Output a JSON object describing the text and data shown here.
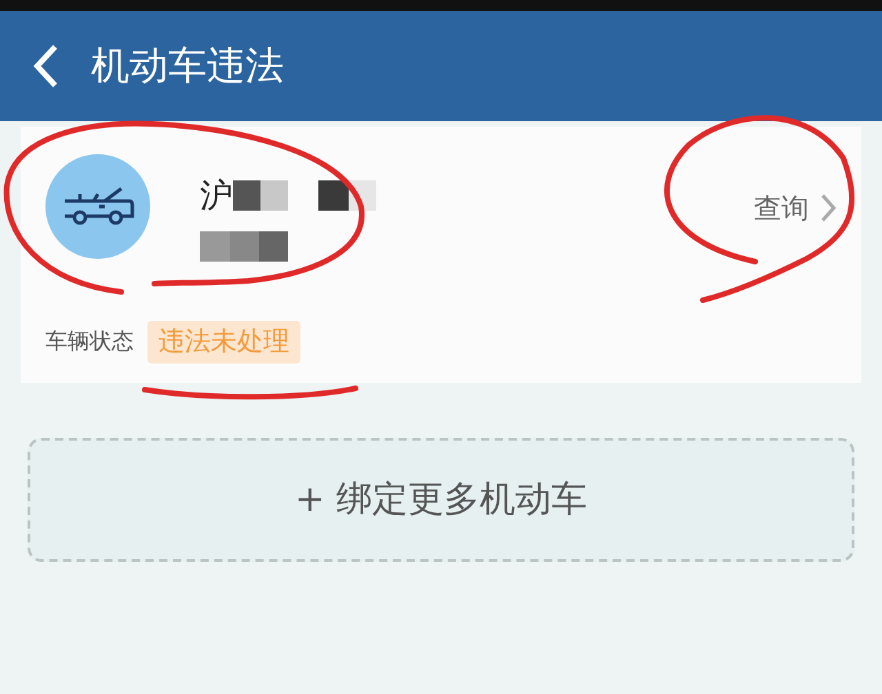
{
  "header": {
    "title": "机动车违法"
  },
  "vehicle": {
    "plate": "沪",
    "query": "查询",
    "status_label": "车辆状态",
    "status": "违法未处理"
  },
  "add_button": {
    "label": "+ 绑定更多机动车"
  }
}
